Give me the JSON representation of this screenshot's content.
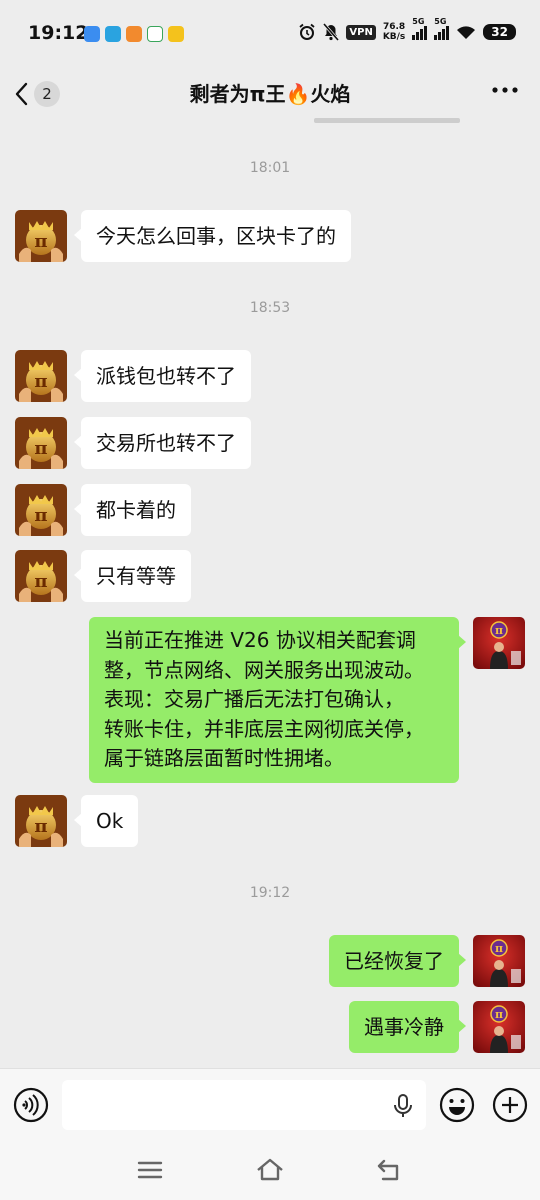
{
  "status_bar": {
    "time": "19:12",
    "net_speed_value": "76.8",
    "net_speed_unit": "KB/s",
    "vpn_label": "VPN",
    "sim1_label": "5G",
    "sim2_label": "5G",
    "battery": "32"
  },
  "chat": {
    "title": "剩者为π王🔥火焰",
    "unread_count": "2"
  },
  "messages": [
    {
      "type": "time",
      "text": "18:01"
    },
    {
      "type": "in",
      "text": "今天怎么回事，区块卡了的"
    },
    {
      "type": "time",
      "text": "18:53"
    },
    {
      "type": "in",
      "text": "派钱包也转不了"
    },
    {
      "type": "in",
      "text": "交易所也转不了"
    },
    {
      "type": "in",
      "text": "都卡着的"
    },
    {
      "type": "in",
      "text": "只有等等"
    },
    {
      "type": "out",
      "lines": [
        "当前正在推进 V26 协议相关配套调",
        "整，节点网络、网关服务出现波动。",
        "表现：交易广播后无法打包确认，",
        "转账卡住，并非底层主网彻底关停，",
        "属于链路层面暂时性拥堵。"
      ]
    },
    {
      "type": "in",
      "text": "Ok"
    },
    {
      "type": "time",
      "text": "19:12"
    },
    {
      "type": "out",
      "text": "已经恢复了"
    },
    {
      "type": "out",
      "text": "遇事冷静"
    }
  ],
  "input": {
    "placeholder": "",
    "value": ""
  },
  "colors": {
    "background": "#ededed",
    "outgoing_bubble": "#95ec69",
    "incoming_bubble": "#ffffff",
    "timestamp": "#9b9b9b"
  },
  "icons": [
    "back-arrow-icon",
    "more-icon",
    "voice-icon",
    "mic-icon",
    "emoji-icon",
    "plus-icon",
    "menu-icon",
    "home-icon",
    "back-nav-icon"
  ]
}
